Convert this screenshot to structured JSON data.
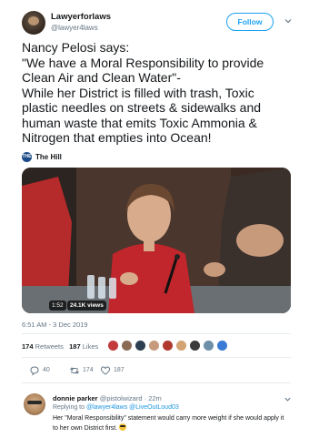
{
  "author": {
    "name": "Lawyerforlaws",
    "handle": "@lawyer4laws"
  },
  "follow_button": "Follow",
  "tweet_lines": [
    "Nancy Pelosi says:",
    "\"We have a Moral Responsibility to provide",
    "Clean Air and Clean Water\"-",
    "While her District is filled with trash, Toxic",
    "plastic needles on streets & sidewalks and",
    "human waste that emits Toxic Ammonia &",
    "Nitrogen that empties into Ocean!"
  ],
  "source": {
    "label": "The Hill",
    "icon": "hill-logo-icon",
    "icon_text": "THE HILL"
  },
  "video": {
    "duration": "1:52",
    "views": "24.1K views"
  },
  "timestamp": "6:51 AM - 3 Dec 2019",
  "stats": {
    "retweets_count": "174",
    "retweets_label": "Retweets",
    "likes_count": "187",
    "likes_label": "Likes"
  },
  "actions": {
    "replies": "40",
    "retweets": "174",
    "likes": "187"
  },
  "reply": {
    "name": "donnie parker",
    "handle": "@pistolwizard",
    "time": "22m",
    "replying_prefix": "Replying to",
    "replying_handles": "@lawyer4laws @LiveOutLoud03",
    "text": "Her \"Moral Responsibility\" statement would carry more weight if she would apply it to her own District first."
  },
  "colors": {
    "accent": "#1da1f2",
    "muted": "#657786",
    "text": "#14171a"
  }
}
